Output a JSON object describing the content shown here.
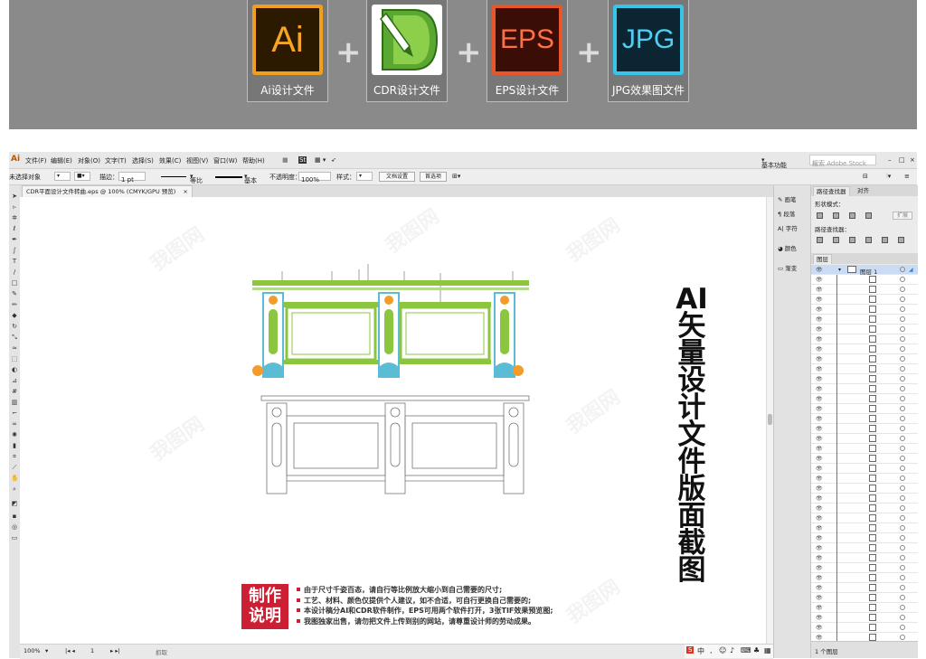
{
  "banner": {
    "formats": [
      {
        "tile_text": "Ai",
        "caption": "Ai设计文件"
      },
      {
        "tile_text": "",
        "caption": "CDR设计文件"
      },
      {
        "tile_text": "EPS",
        "caption": "EPS设计文件"
      },
      {
        "tile_text": "JPG",
        "caption": "JPG效果图文件"
      }
    ],
    "plus": "+"
  },
  "app": {
    "logo": "Ai",
    "menu": [
      "文件(F)",
      "编辑(E)",
      "对象(O)",
      "文字(T)",
      "选择(S)",
      "效果(C)",
      "视图(V)",
      "窗口(W)",
      "帮助(H)"
    ],
    "workspace": "基本功能",
    "stock_search": "搜索 Adobe Stock",
    "control": {
      "selection": "未选择对象",
      "stroke_label": "描边：",
      "stroke_value": "1 pt",
      "ratio": "等比",
      "brush": "基本",
      "opacity_label": "不透明度：",
      "opacity_value": "100%",
      "style_label": "样式：",
      "doc_setup": "文档设置",
      "prefs": "首选项"
    },
    "doc_tab": "CDR平面设计文件转曲.eps @ 100% (CMYK/GPU 预览)",
    "doc_tab_close": "×",
    "zoom": "100%",
    "page_number": "1",
    "status_tool": "抓取",
    "dock": [
      "画笔",
      "段落",
      "字符",
      "颜色",
      "渐变"
    ],
    "panel": {
      "tabs": [
        "路径查找器",
        "对齐"
      ],
      "shape_modes": "形状模式：",
      "expand": "扩展",
      "pathfinders": "路径查找器：",
      "layers_tab": "图层",
      "top_layer": "图层 1",
      "footer": "1 个图层"
    },
    "ime": "中"
  },
  "canvas": {
    "vertical_title": "AI矢量设计文件版面截图",
    "badge": "制作说明",
    "notes": [
      "由于尺寸千姿百态，请自行等比例放大缩小到自己需要的尺寸;",
      "工艺、材料、颜色仅提供个人建议，如不合适，可自行更换自己需要的;",
      "本设计稿分AI和CDR软件制作，EPS可用两个软件打开，3张TIF效果预览图;",
      "我图独家出售，请勿把文件上传到别的网站，请尊重设计师的劳动成果。"
    ],
    "watermark": "我图网",
    "colors": {
      "accent_green": "#8cc63f",
      "accent_teal": "#5bbcd6",
      "accent_orange": "#f39c2a",
      "badge_red": "#cd1f33"
    }
  }
}
